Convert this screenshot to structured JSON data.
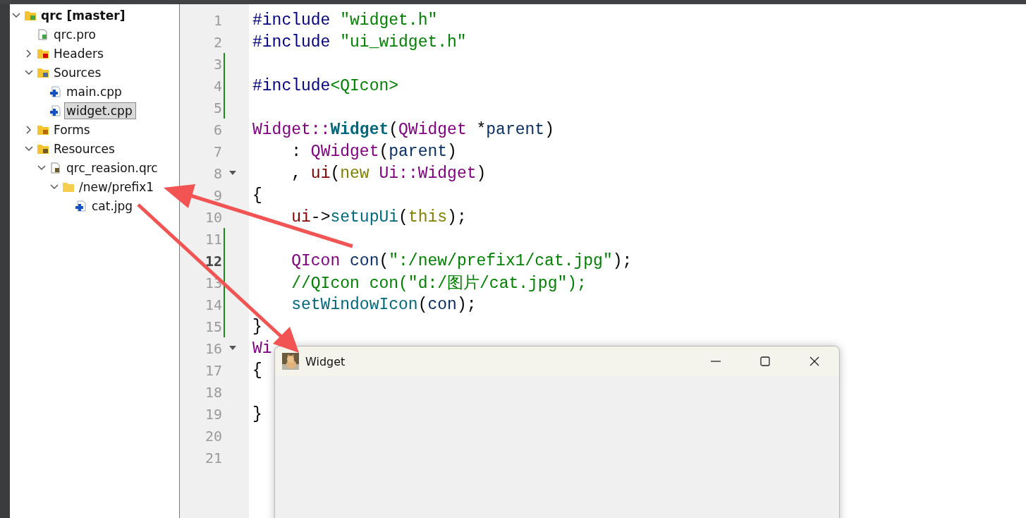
{
  "project_tree": [
    {
      "label": "qrc [master]",
      "kind": "project",
      "expanded": true,
      "selected": false,
      "children": [
        {
          "label": "qrc.pro",
          "kind": "pro",
          "selected": false
        },
        {
          "label": "Headers",
          "kind": "headers",
          "expanded": false,
          "selected": false
        },
        {
          "label": "Sources",
          "kind": "sources",
          "expanded": true,
          "selected": false,
          "children": [
            {
              "label": "main.cpp",
              "kind": "cpp",
              "selected": false
            },
            {
              "label": "widget.cpp",
              "kind": "cpp",
              "selected": true
            }
          ]
        },
        {
          "label": "Forms",
          "kind": "forms",
          "expanded": false,
          "selected": false
        },
        {
          "label": "Resources",
          "kind": "resources",
          "expanded": true,
          "selected": false,
          "children": [
            {
              "label": "qrc_reasion.qrc",
              "kind": "qrc",
              "expanded": true,
              "selected": false,
              "children": [
                {
                  "label": "/new/prefix1",
                  "kind": "folder",
                  "expanded": true,
                  "selected": false,
                  "children": [
                    {
                      "label": "cat.jpg",
                      "kind": "cpp",
                      "selected": false
                    }
                  ]
                }
              ]
            }
          ]
        }
      ]
    }
  ],
  "editor": {
    "lines": [
      {
        "number": "1",
        "current": false,
        "changed": false,
        "fold": false,
        "tokens": [
          {
            "kind": "directive",
            "text": "#include "
          },
          {
            "kind": "string",
            "text": "\"widget.h\""
          }
        ]
      },
      {
        "number": "2",
        "current": false,
        "changed": false,
        "fold": false,
        "tokens": [
          {
            "kind": "directive",
            "text": "#include "
          },
          {
            "kind": "string",
            "text": "\"ui_widget.h\""
          }
        ]
      },
      {
        "number": "3",
        "current": false,
        "changed": true,
        "fold": false
      },
      {
        "number": "4",
        "current": false,
        "changed": true,
        "fold": false,
        "tokens": [
          {
            "kind": "directive",
            "text": "#include"
          },
          {
            "kind": "string",
            "text": "<QIcon>"
          }
        ]
      },
      {
        "number": "5",
        "current": false,
        "changed": true,
        "fold": false
      },
      {
        "number": "6",
        "current": false,
        "changed": false,
        "fold": false,
        "tokens": [
          {
            "kind": "type",
            "text": "Widget::"
          },
          {
            "kind": "declaration",
            "text": "Widget"
          },
          {
            "kind": "plain",
            "text": "("
          },
          {
            "kind": "type",
            "text": "QWidget"
          },
          {
            "kind": "plain",
            "text": " *"
          },
          {
            "kind": "param",
            "text": "parent"
          },
          {
            "kind": "plain",
            "text": ")"
          }
        ]
      },
      {
        "number": "7",
        "current": false,
        "changed": false,
        "fold": false,
        "tokens": [
          {
            "kind": "plain",
            "text": "    : "
          },
          {
            "kind": "type",
            "text": "QWidget"
          },
          {
            "kind": "plain",
            "text": "("
          },
          {
            "kind": "param",
            "text": "parent"
          },
          {
            "kind": "plain",
            "text": ")"
          }
        ]
      },
      {
        "number": "8",
        "current": false,
        "changed": false,
        "fold": true,
        "tokens": [
          {
            "kind": "plain",
            "text": "    , "
          },
          {
            "kind": "member",
            "text": "ui"
          },
          {
            "kind": "plain",
            "text": "("
          },
          {
            "kind": "keyword",
            "text": "new "
          },
          {
            "kind": "type",
            "text": "Ui::Widget"
          },
          {
            "kind": "plain",
            "text": ")"
          }
        ]
      },
      {
        "number": "9",
        "current": false,
        "changed": false,
        "fold": false,
        "tokens": [
          {
            "kind": "plain",
            "text": "{"
          }
        ]
      },
      {
        "number": "10",
        "current": false,
        "changed": false,
        "fold": false,
        "tokens": [
          {
            "kind": "member",
            "text": "    ui"
          },
          {
            "kind": "plain",
            "text": "->"
          },
          {
            "kind": "function",
            "text": "setupUi"
          },
          {
            "kind": "plain",
            "text": "("
          },
          {
            "kind": "keyword",
            "text": "this"
          },
          {
            "kind": "plain",
            "text": ");"
          }
        ]
      },
      {
        "number": "11",
        "current": false,
        "changed": true,
        "fold": false
      },
      {
        "number": "12",
        "current": true,
        "changed": true,
        "fold": false,
        "tokens": [
          {
            "kind": "type",
            "text": "    QIcon "
          },
          {
            "kind": "param",
            "text": "con"
          },
          {
            "kind": "plain",
            "text": "("
          },
          {
            "kind": "string",
            "text": "\":/new/prefix1/cat.jpg\""
          },
          {
            "kind": "plain",
            "text": ");"
          }
        ]
      },
      {
        "number": "13",
        "current": false,
        "changed": true,
        "fold": false,
        "tokens": [
          {
            "kind": "comment",
            "text": "    //QIcon con(\"d:/图片/cat.jpg\");"
          }
        ]
      },
      {
        "number": "14",
        "current": false,
        "changed": true,
        "fold": false,
        "tokens": [
          {
            "kind": "function",
            "text": "    setWindowIcon"
          },
          {
            "kind": "plain",
            "text": "("
          },
          {
            "kind": "param",
            "text": "con"
          },
          {
            "kind": "plain",
            "text": ");"
          }
        ]
      },
      {
        "number": "15",
        "current": false,
        "changed": true,
        "fold": false,
        "tokens": [
          {
            "kind": "plain",
            "text": "}"
          }
        ]
      },
      {
        "number": "16",
        "current": false,
        "changed": false,
        "fold": true,
        "tokens": [
          {
            "kind": "type",
            "text": "Wi"
          }
        ]
      },
      {
        "number": "17",
        "current": false,
        "changed": false,
        "fold": false,
        "tokens": [
          {
            "kind": "plain",
            "text": "{"
          }
        ]
      },
      {
        "number": "18",
        "current": false,
        "changed": false,
        "fold": false
      },
      {
        "number": "19",
        "current": false,
        "changed": false,
        "fold": false,
        "tokens": [
          {
            "kind": "plain",
            "text": "}"
          }
        ]
      },
      {
        "number": "20",
        "current": false,
        "changed": false,
        "fold": false
      },
      {
        "number": "21",
        "current": false,
        "changed": false,
        "fold": false
      }
    ]
  },
  "widget_window": {
    "title": "Widget"
  }
}
